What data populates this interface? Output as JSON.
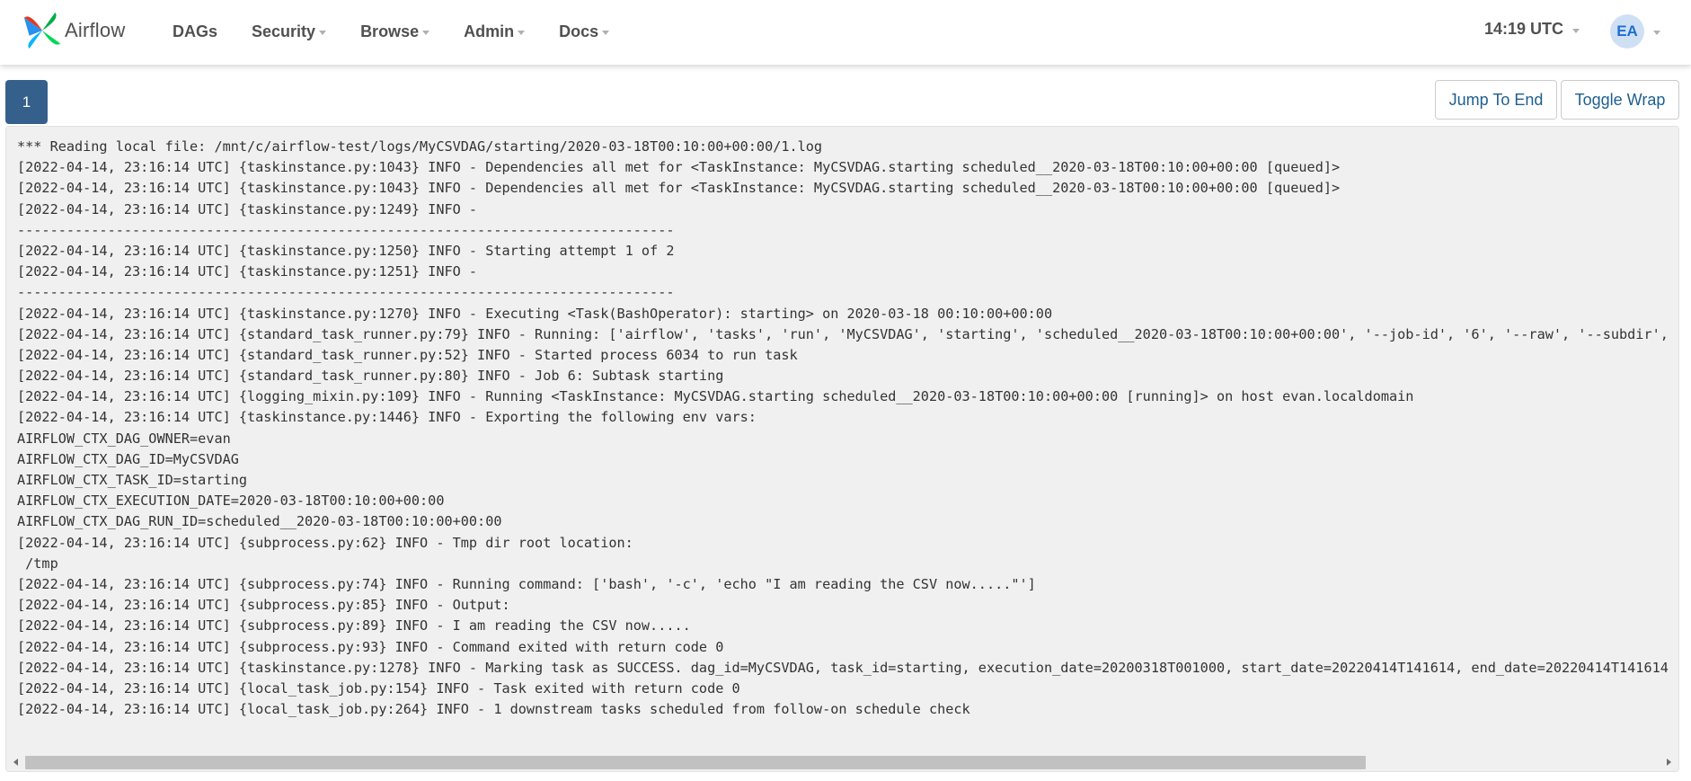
{
  "navbar": {
    "brand": "Airflow",
    "menu": [
      {
        "label": "DAGs",
        "caret": false
      },
      {
        "label": "Security",
        "caret": true
      },
      {
        "label": "Browse",
        "caret": true
      },
      {
        "label": "Admin",
        "caret": true
      },
      {
        "label": "Docs",
        "caret": true
      }
    ],
    "time": "14:19 UTC",
    "user_initials": "EA"
  },
  "controls": {
    "page_number": "1",
    "jump_label": "Jump To End",
    "wrap_label": "Toggle Wrap"
  },
  "log_lines": [
    "*** Reading local file: /mnt/c/airflow-test/logs/MyCSVDAG/starting/2020-03-18T00:10:00+00:00/1.log",
    "[2022-04-14, 23:16:14 UTC] {taskinstance.py:1043} INFO - Dependencies all met for <TaskInstance: MyCSVDAG.starting scheduled__2020-03-18T00:10:00+00:00 [queued]>",
    "[2022-04-14, 23:16:14 UTC] {taskinstance.py:1043} INFO - Dependencies all met for <TaskInstance: MyCSVDAG.starting scheduled__2020-03-18T00:10:00+00:00 [queued]>",
    "[2022-04-14, 23:16:14 UTC] {taskinstance.py:1249} INFO - ",
    "--------------------------------------------------------------------------------",
    "[2022-04-14, 23:16:14 UTC] {taskinstance.py:1250} INFO - Starting attempt 1 of 2",
    "[2022-04-14, 23:16:14 UTC] {taskinstance.py:1251} INFO - ",
    "--------------------------------------------------------------------------------",
    "[2022-04-14, 23:16:14 UTC] {taskinstance.py:1270} INFO - Executing <Task(BashOperator): starting> on 2020-03-18 00:10:00+00:00",
    "[2022-04-14, 23:16:14 UTC] {standard_task_runner.py:79} INFO - Running: ['airflow', 'tasks', 'run', 'MyCSVDAG', 'starting', 'scheduled__2020-03-18T00:10:00+00:00', '--job-id', '6', '--raw', '--subdir', 'DAGS",
    "[2022-04-14, 23:16:14 UTC] {standard_task_runner.py:52} INFO - Started process 6034 to run task",
    "[2022-04-14, 23:16:14 UTC] {standard_task_runner.py:80} INFO - Job 6: Subtask starting",
    "[2022-04-14, 23:16:14 UTC] {logging_mixin.py:109} INFO - Running <TaskInstance: MyCSVDAG.starting scheduled__2020-03-18T00:10:00+00:00 [running]> on host evan.localdomain",
    "[2022-04-14, 23:16:14 UTC] {taskinstance.py:1446} INFO - Exporting the following env vars:",
    "AIRFLOW_CTX_DAG_OWNER=evan",
    "AIRFLOW_CTX_DAG_ID=MyCSVDAG",
    "AIRFLOW_CTX_TASK_ID=starting",
    "AIRFLOW_CTX_EXECUTION_DATE=2020-03-18T00:10:00+00:00",
    "AIRFLOW_CTX_DAG_RUN_ID=scheduled__2020-03-18T00:10:00+00:00",
    "[2022-04-14, 23:16:14 UTC] {subprocess.py:62} INFO - Tmp dir root location: ",
    " /tmp",
    "[2022-04-14, 23:16:14 UTC] {subprocess.py:74} INFO - Running command: ['bash', '-c', 'echo \"I am reading the CSV now.....\"']",
    "[2022-04-14, 23:16:14 UTC] {subprocess.py:85} INFO - Output:",
    "[2022-04-14, 23:16:14 UTC] {subprocess.py:89} INFO - I am reading the CSV now.....",
    "[2022-04-14, 23:16:14 UTC] {subprocess.py:93} INFO - Command exited with return code 0",
    "[2022-04-14, 23:16:14 UTC] {taskinstance.py:1278} INFO - Marking task as SUCCESS. dag_id=MyCSVDAG, task_id=starting, execution_date=20200318T001000, start_date=20220414T141614, end_date=20220414T141614",
    "[2022-04-14, 23:16:14 UTC] {local_task_job.py:154} INFO - Task exited with return code 0",
    "[2022-04-14, 23:16:14 UTC] {local_task_job.py:264} INFO - 1 downstream tasks scheduled from follow-on schedule check"
  ],
  "scrollbar": {
    "horizontal_position": 0.0,
    "visible_fraction": 0.82
  }
}
